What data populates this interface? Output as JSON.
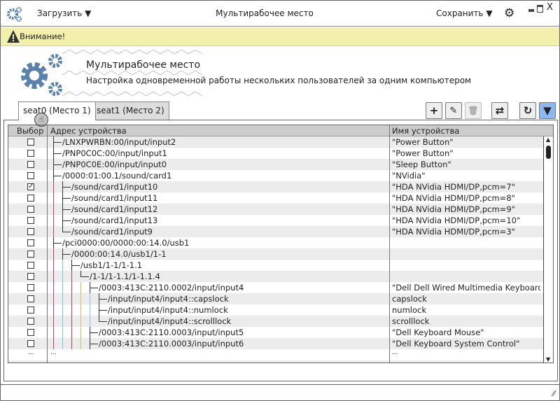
{
  "titlebar": {
    "load_label": "Загрузить",
    "title": "Мультирабочее место",
    "save_label": "Сохранить"
  },
  "warning": {
    "text": "Внимание!"
  },
  "hero": {
    "title": "Мультирабочее место",
    "subtitle": "Настройка одновременной работы нескольких пользователей за одним компьютером"
  },
  "tabs": [
    {
      "label": "seat0 (Место 1)",
      "active": true
    },
    {
      "label": "seat1 (Место 2)",
      "active": false
    }
  ],
  "toolbar": [
    "add-icon",
    "edit-icon",
    "delete-icon",
    "swap-icon",
    "refresh-icon",
    "filter-icon"
  ],
  "accent": "#8ab8f0",
  "brand": "#5b82ad",
  "table": {
    "columns": [
      "Выбор",
      "Адрес устройства",
      "Имя устройства"
    ],
    "rows": [
      {
        "checked": false,
        "depth": 0,
        "last": false,
        "address": "/LNXPWRBN:00/input/input2",
        "name": "\"Power Button\""
      },
      {
        "checked": false,
        "depth": 0,
        "last": false,
        "address": "/PNP0C0C:00/input/input1",
        "name": "\"Power Button\""
      },
      {
        "checked": false,
        "depth": 0,
        "last": false,
        "address": "/PNP0C0E:00/input/input0",
        "name": "\"Sleep Button\""
      },
      {
        "checked": false,
        "depth": 0,
        "last": false,
        "address": "/0000:01:00.1/sound/card1",
        "name": "\"NVidia\""
      },
      {
        "checked": true,
        "depth": 1,
        "last": false,
        "address": "/sound/card1/input10",
        "name": "\"HDA NVidia HDMI/DP,pcm=7\""
      },
      {
        "checked": false,
        "depth": 1,
        "last": false,
        "address": "/sound/card1/input11",
        "name": "\"HDA NVidia HDMI/DP,pcm=8\""
      },
      {
        "checked": false,
        "depth": 1,
        "last": false,
        "address": "/sound/card1/input12",
        "name": "\"HDA NVidia HDMI/DP,pcm=9\""
      },
      {
        "checked": false,
        "depth": 1,
        "last": false,
        "address": "/sound/card1/input13",
        "name": "\"HDA NVidia HDMI/DP,pcm=10\""
      },
      {
        "checked": false,
        "depth": 1,
        "last": true,
        "address": "/sound/card1/input9",
        "name": "\"HDA NVidia HDMI/DP,pcm=3\""
      },
      {
        "checked": false,
        "depth": 0,
        "last": false,
        "address": "/pci0000:00/0000:00:14.0/usb1",
        "name": ""
      },
      {
        "checked": false,
        "depth": 1,
        "last": false,
        "address": "/0000:00:14.0/usb1/1-1",
        "name": ""
      },
      {
        "checked": false,
        "depth": 2,
        "last": false,
        "address": "/usb1/1-1/1-1.1",
        "name": ""
      },
      {
        "checked": false,
        "depth": 3,
        "last": true,
        "address": "/1-1/1-1.1/1-1.1.4",
        "name": ""
      },
      {
        "checked": false,
        "depth": 4,
        "last": false,
        "address": "/0003:413C:2110.0002/input/input4",
        "name": "\"Dell Dell Wired Multimedia Keyboard\""
      },
      {
        "checked": false,
        "depth": 5,
        "last": false,
        "address": "/input/input4/input4::capslock",
        "name": "capslock"
      },
      {
        "checked": false,
        "depth": 5,
        "last": false,
        "address": "/input/input4/input4::numlock",
        "name": "numlock"
      },
      {
        "checked": false,
        "depth": 5,
        "last": true,
        "address": "/input/input4/input4::scrolllock",
        "name": "scrolllock"
      },
      {
        "checked": false,
        "depth": 4,
        "last": false,
        "address": "/0003:413C:2110.0003/input/input5",
        "name": "\"Dell Keyboard Mouse\""
      },
      {
        "checked": false,
        "depth": 4,
        "last": false,
        "address": "/0003:413C:2110.0003/input/input6",
        "name": "\"Dell Keyboard System Control\""
      }
    ],
    "ellipsis": "..."
  }
}
